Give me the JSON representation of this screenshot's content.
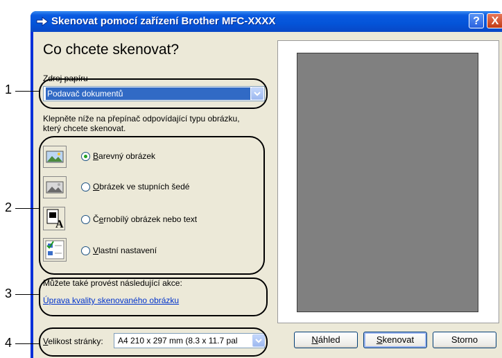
{
  "window": {
    "title": "Skenovat pomocí zařízení Brother MFC-XXXX",
    "help_label": "?",
    "close_label": "X"
  },
  "heading": "Co chcete skenovat?",
  "paper_source": {
    "label": "Zdroj papíru",
    "value": "Podavač dokumentů"
  },
  "instruction": {
    "line1": "Klepněte níže na přepínač odpovídající typu obrázku,",
    "line2": "který chcete skenovat."
  },
  "options": [
    {
      "mnemonic": "B",
      "rest": "arevný obrázek",
      "selected": true,
      "icon": "color-photo-icon"
    },
    {
      "mnemonic": "O",
      "rest": "brázek ve stupních šedé",
      "selected": false,
      "icon": "grayscale-photo-icon"
    },
    {
      "prefix": "Č",
      "mnemonic": "e",
      "rest": "rnobílý obrázek nebo text",
      "selected": false,
      "icon": "bw-text-icon"
    },
    {
      "mnemonic": "V",
      "rest": "lastní nastavení",
      "selected": false,
      "icon": "custom-settings-icon"
    }
  ],
  "also": {
    "text": "Můžete také provést následující akce:",
    "link": "Úprava kvality skenovaného obrázku"
  },
  "page_size": {
    "label_mnemonic": "V",
    "label_rest": "elikost stránky:",
    "value": "A4 210 x 297 mm (8.3 x 11.7 pal"
  },
  "buttons": {
    "preview_mn": "N",
    "preview_rest": "áhled",
    "scan_mn": "S",
    "scan_rest": "kenovat",
    "cancel": "Storno"
  },
  "callouts": [
    "1",
    "2",
    "3",
    "4"
  ],
  "colors": {
    "title_bar": "#0a5ae0",
    "selection": "#316ac5",
    "client_bg": "#ece9d8",
    "link": "#0033cc",
    "preview_page": "#808080"
  }
}
